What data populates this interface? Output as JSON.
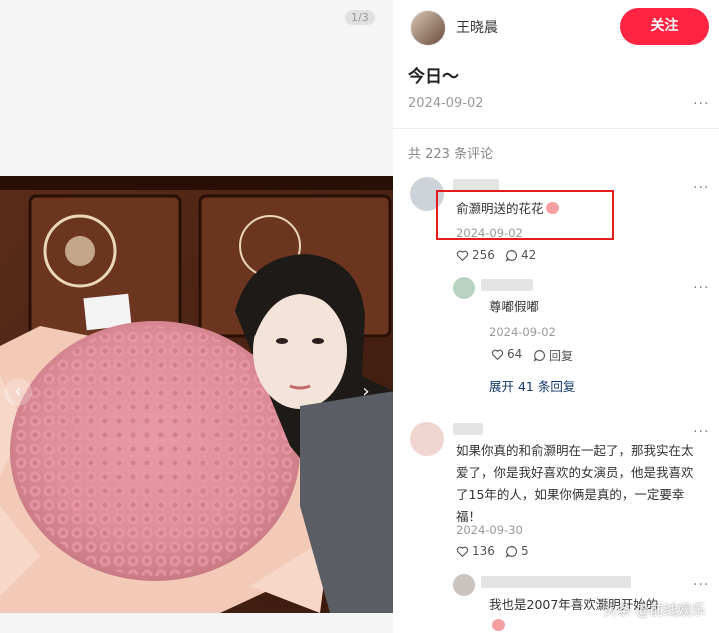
{
  "media": {
    "page_indicator": "1/3",
    "prev_icon": "chevron-left-icon",
    "next_icon": "chevron-right-icon"
  },
  "author": {
    "name": "王晓晨",
    "follow_label": "关注"
  },
  "post": {
    "title": "今日～",
    "date": "2024-09-02"
  },
  "comments_header": "共 223 条评论",
  "comments": [
    {
      "text": "俞灏明送的花花",
      "date": "2024-09-02",
      "likes": "256",
      "replies": "42"
    },
    {
      "text": "尊嘟假嘟",
      "date": "2024-09-02",
      "likes": "64",
      "reply_label": "回复"
    },
    {
      "expand_label": "展开 41 条回复"
    },
    {
      "text_lines": [
        "如果你真的和俞灏明在一起了，那我实在太",
        "爱了，你是我好喜欢的女演员，他是我喜欢",
        "了15年的人，如果你俩是真的，一定要幸",
        "福！"
      ],
      "date": "2024-09-30",
      "likes": "136",
      "replies": "5"
    },
    {
      "text": "我也是2007年喜欢灏明开始的"
    }
  ],
  "watermark": "头条 @前线娱乐",
  "colors": {
    "accent": "#ff2442",
    "highlight": "#e31c1c",
    "link": "#13386c"
  }
}
